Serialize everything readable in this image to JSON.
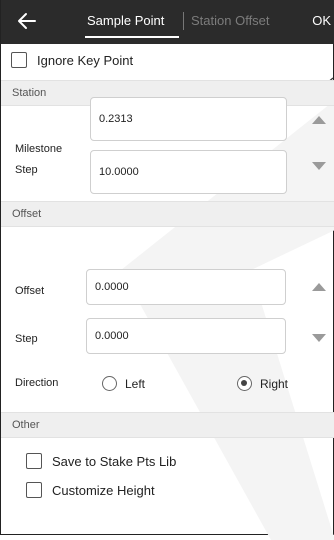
{
  "header": {
    "back_icon": "arrow-left-icon",
    "tabs": [
      {
        "label": "Sample Point",
        "active": true
      },
      {
        "label": "Station Offset",
        "active": false
      }
    ],
    "ok_label": "OK"
  },
  "ignore_key_point": {
    "label": "Ignore Key Point",
    "checked": false
  },
  "station": {
    "title": "Station",
    "milestone_label": "Milestone",
    "milestone_value": "0.2313",
    "step_label": "Step",
    "step_value": "10.0000"
  },
  "offset": {
    "title": "Offset",
    "offset_label": "Offset",
    "offset_value": "0.0000",
    "step_label": "Step",
    "step_value": "0.0000",
    "direction_label": "Direction",
    "options": [
      {
        "label": "Left",
        "selected": false
      },
      {
        "label": "Right",
        "selected": true
      }
    ]
  },
  "other": {
    "title": "Other",
    "save_label": "Save to Stake Pts Lib",
    "save_checked": false,
    "height_label": "Customize Height",
    "height_checked": false
  },
  "colors": {
    "topbar": "#2b2b2b",
    "section_bg": "#efefef",
    "arrow_gray": "#9a9a9a"
  }
}
